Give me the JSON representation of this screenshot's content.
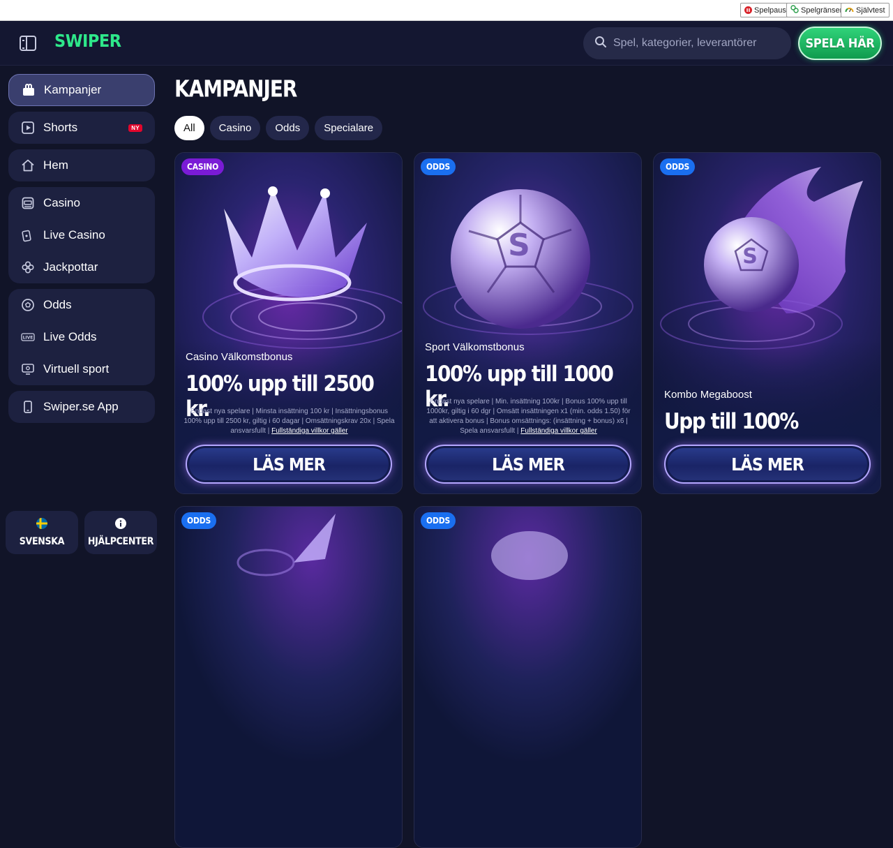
{
  "responsible_gaming": {
    "spelpaus": "Spelpaus",
    "spelgranser": "Spelgränser",
    "sjalvtest": "Självtest"
  },
  "header": {
    "logo": "SWIPER",
    "search_placeholder": "Spel, kategorier, leverantörer",
    "play_button": "SPELA HÄR"
  },
  "sidebar": {
    "items": [
      {
        "label": "Kampanjer",
        "icon": "gift-icon",
        "active": true
      },
      {
        "label": "Shorts",
        "icon": "play-icon",
        "badge": "NY"
      },
      {
        "label": "Hem",
        "icon": "home-icon"
      },
      {
        "label": "Casino",
        "icon": "slot-machine-icon"
      },
      {
        "label": "Live Casino",
        "icon": "cards-icon"
      },
      {
        "label": "Jackpottar",
        "icon": "clover-icon"
      },
      {
        "label": "Odds",
        "icon": "football-icon"
      },
      {
        "label": "Live Odds",
        "icon": "live-icon"
      },
      {
        "label": "Virtuell sport",
        "icon": "monitor-icon"
      },
      {
        "label": "Swiper.se App",
        "icon": "phone-icon"
      }
    ],
    "footer": {
      "language": "SVENSKA",
      "help": "HJÄLPCENTER"
    }
  },
  "main": {
    "title": "KAMPANJER",
    "filters": [
      "All",
      "Casino",
      "Odds",
      "Specialare"
    ],
    "active_filter": "All",
    "cards": [
      {
        "tag": "CASINO",
        "subtitle": "Casino Välkomstbonus",
        "headline": "100% upp till 2500 kr.",
        "terms": "Endast nya spelare | Minsta insättning 100 kr | Insättningsbonus 100% upp till 2500 kr, giltig i 60 dagar | Omsättningskrav 20x | Spela ansvarsfullt |",
        "terms_link": "Fullständiga villkor gäller",
        "cta": "LÄS MER"
      },
      {
        "tag": "ODDS",
        "subtitle": "Sport Välkomstbonus",
        "headline": "100% upp till 1000 kr.",
        "terms": "Endast nya spelare | Min. insättning 100kr | Bonus 100% upp till 1000kr, giltig i 60 dgr | Omsätt insättningen x1 (min. odds 1.50) för att aktivera bonus | Bonus omsättnings: (insättning + bonus) x6 | Spela ansvarsfullt |",
        "terms_link": "Fullständiga villkor gäller",
        "cta": "LÄS MER"
      },
      {
        "tag": "ODDS",
        "subtitle": "Kombo Megaboost",
        "headline": "Upp till 100%",
        "cta": "LÄS MER"
      },
      {
        "tag": "ODDS"
      },
      {
        "tag": "ODDS"
      }
    ]
  },
  "colors": {
    "background": "#111428",
    "brand_green": "#2ee88a",
    "casino_tag": "#7a1bd6",
    "odds_tag": "#1a6ff0",
    "new_badge": "#e2062c"
  }
}
